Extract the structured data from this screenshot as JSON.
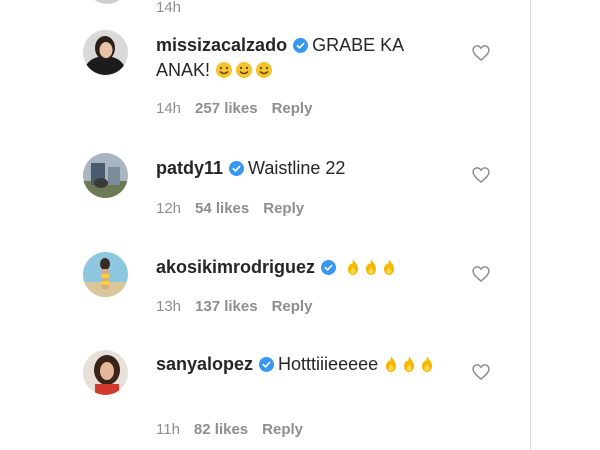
{
  "top_comment": {
    "time": "14h"
  },
  "comments": [
    {
      "username": "missizacalzado",
      "text": "GRABE KA ANAK!",
      "emoji": [
        "smile",
        "smile",
        "smile"
      ],
      "time": "14h",
      "likes": "257 likes",
      "reply": "Reply"
    },
    {
      "username": "patdy11",
      "text": "Waistline 22",
      "emoji": [],
      "time": "12h",
      "likes": "54 likes",
      "reply": "Reply"
    },
    {
      "username": "akosikimrodriguez",
      "text": "",
      "emoji": [
        "fire",
        "fire",
        "fire"
      ],
      "time": "13h",
      "likes": "137 likes",
      "reply": "Reply"
    },
    {
      "username": "sanyalopez",
      "text": "Hotttiiieeeee",
      "emoji": [
        "fire",
        "fire",
        "fire"
      ],
      "time": "11h",
      "likes": "82 likes",
      "reply": "Reply"
    }
  ],
  "colors": {
    "verified": "#3897f0",
    "meta": "#8e8e8e",
    "text": "#262626",
    "emoji_face": "#f4c430"
  },
  "icons": {
    "verified": "verified-badge-icon",
    "like": "heart-outline-icon",
    "emoji_smile": "smiling-face-emoji",
    "emoji_fire": "flame-emoji"
  }
}
